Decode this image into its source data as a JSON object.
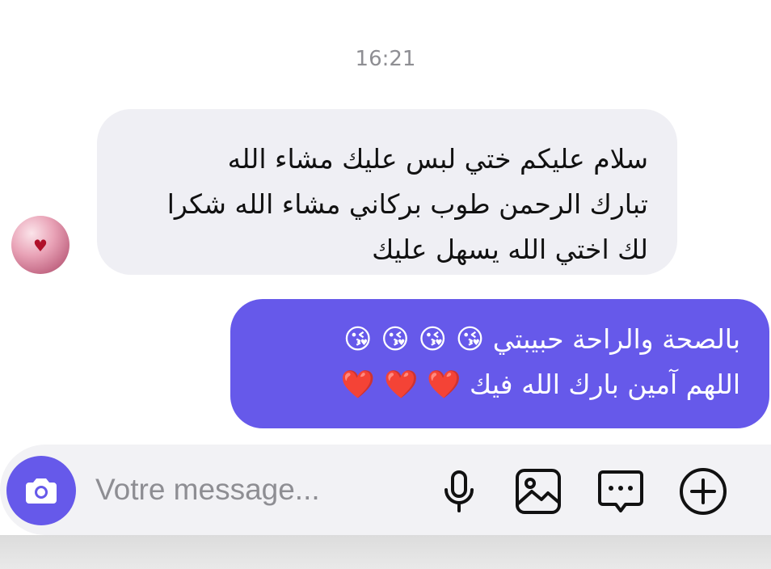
{
  "conversation": {
    "timestamp": "16:21",
    "incoming": {
      "lines": [
        "سلام عليكم ختي لبس عليك مشاء الله",
        "تبارك الرحمن طوب بركاني مشاء الله شكرا",
        "لك اختي الله يسهل عليك"
      ]
    },
    "outgoing": {
      "line1_text": "بالصحة والراحة حبيبتي",
      "line1_emoji": "😘 😘 😘 😘",
      "line2_text": "اللهم آمين بارك الله فيك",
      "line2_emoji": "❤️ ❤️ ❤️"
    }
  },
  "composer": {
    "placeholder": "Votre message...",
    "icons": [
      "camera-icon",
      "microphone-icon",
      "image-icon",
      "sticker-icon",
      "add-icon"
    ]
  },
  "colors": {
    "accent": "#6659ea",
    "incoming_bubble": "#efeff4",
    "timestamp": "#8e8e93"
  }
}
